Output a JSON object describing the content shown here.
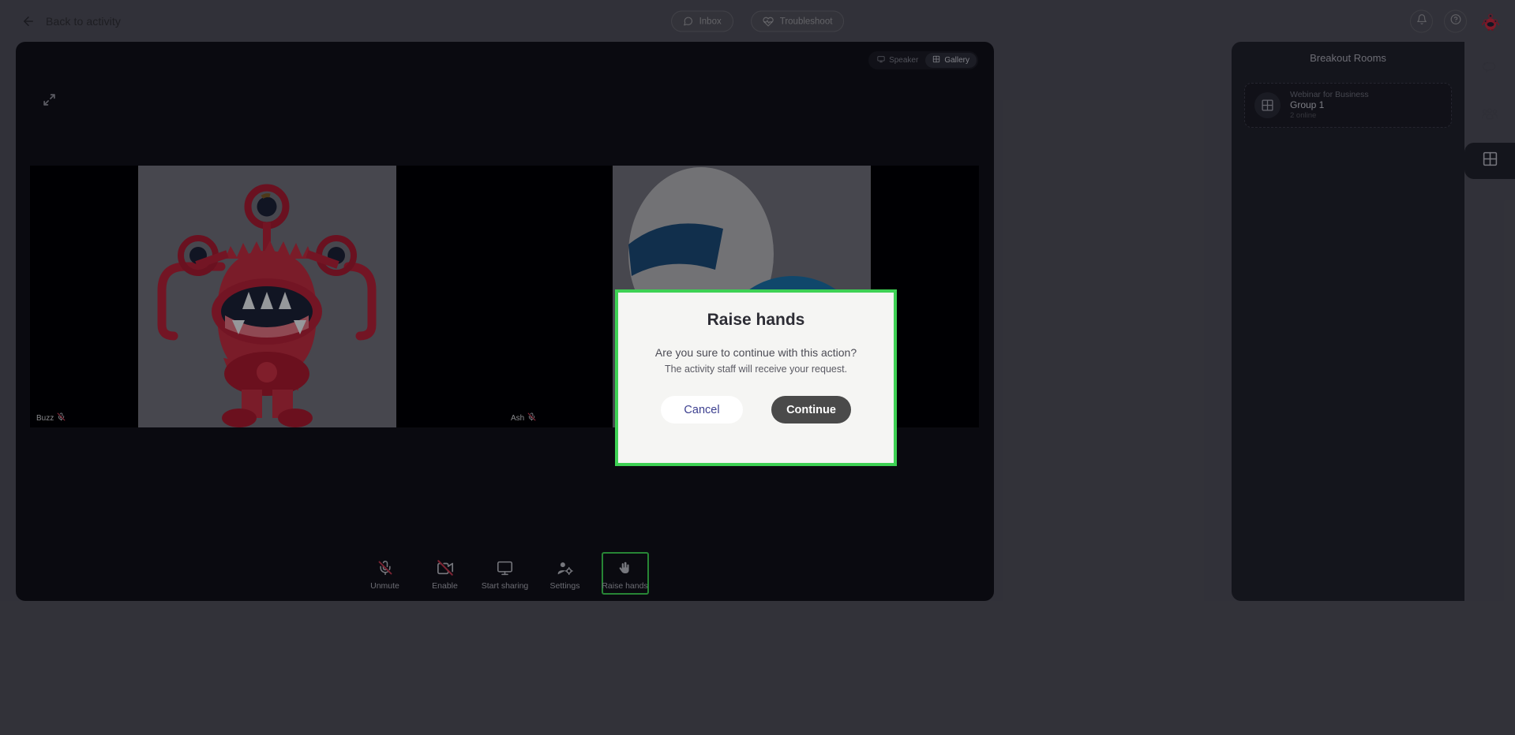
{
  "topbar": {
    "back_label": "Back to activity",
    "back_icon": "arrow-left-icon",
    "pills": [
      {
        "label": "Inbox",
        "icon": "chat-bubble-icon"
      },
      {
        "label": "Troubleshoot",
        "icon": "heart-pulse-icon"
      }
    ],
    "right_icons": [
      {
        "name": "bell-icon"
      },
      {
        "name": "help-circle-icon"
      }
    ],
    "avatar": {
      "name": "user-avatar",
      "alt": "Red monster avatar"
    }
  },
  "stage": {
    "fullscreen_icon": "fullscreen-expand-icon",
    "view_toggle": {
      "options": [
        {
          "label": "Speaker",
          "icon": "screen-icon",
          "active": false
        },
        {
          "label": "Gallery",
          "icon": "grid-icon",
          "active": true
        }
      ]
    },
    "tiles": [
      {
        "name": "Buzz",
        "muted": true,
        "avatar": "red-monster-illustration"
      },
      {
        "name": "Ash",
        "muted": true,
        "avatar": "astronaut-earth-illustration"
      }
    ]
  },
  "toolbar": {
    "items": [
      {
        "label": "Unmute",
        "icon": "mic-off-icon",
        "highlighted": false
      },
      {
        "label": "Enable",
        "icon": "camera-off-icon",
        "highlighted": false
      },
      {
        "label": "Start sharing",
        "icon": "monitor-share-icon",
        "highlighted": false
      },
      {
        "label": "Settings",
        "icon": "user-settings-icon",
        "highlighted": false
      },
      {
        "label": "Raise hands",
        "icon": "raise-hand-icon",
        "highlighted": true
      }
    ]
  },
  "right_panel": {
    "title": "Breakout Rooms",
    "room": {
      "icon": "grid-icon",
      "subtitle": "Webinar for Business",
      "name": "Group 1",
      "online": "2 online"
    }
  },
  "rail": {
    "buttons": [
      {
        "name": "chat-icon",
        "active": false
      },
      {
        "name": "participants-icon",
        "active": false
      },
      {
        "name": "breakout-grid-icon",
        "active": true
      }
    ]
  },
  "modal": {
    "title": "Raise hands",
    "line1": "Are you sure to continue with this action?",
    "line2": "The activity staff will receive your request.",
    "cancel_label": "Cancel",
    "continue_label": "Continue"
  },
  "colors": {
    "page_bg": "#4e4e59",
    "stage_bg": "#10111a",
    "panel_bg": "#20212c",
    "accent_green": "#3ed154",
    "modal_bg": "#f5f5f3",
    "continue_btn": "#4a4a4a",
    "cancel_text": "#3c3f8f"
  }
}
